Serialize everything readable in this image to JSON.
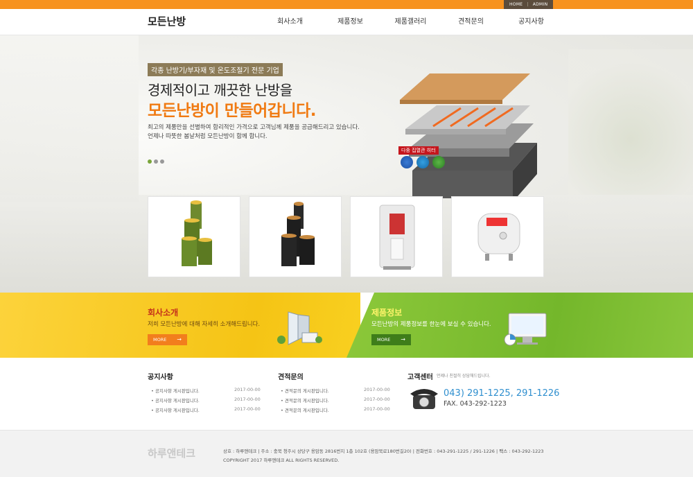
{
  "topbar": {
    "home": "HOME",
    "sep": "|",
    "admin": "ADMIN"
  },
  "header": {
    "logo": "모든난방",
    "nav": [
      "회사소개",
      "제품정보",
      "제품갤러리",
      "견적문의",
      "공지사항"
    ]
  },
  "hero": {
    "tag": "각종 난방기/부자재 및 온도조절기 전문 기업",
    "headline1": "경제적이고 깨끗한 난방을",
    "headline2": "모든난방이 만들어갑니다.",
    "desc1": "최고의 제품만을 선별하여 합리적인 가격으로 고객님께 제품을 공급해드리고 있습니다.",
    "desc2": "언제나 따뜻한 봄날처럼 모든난방이 함께 합니다.",
    "badge": "다중 집열관 히터",
    "slide_active": 1,
    "slide_count": 3
  },
  "products": [
    {
      "icon": "heating-film-roll-green-icon"
    },
    {
      "icon": "heating-film-roll-black-icon"
    },
    {
      "icon": "electric-boiler-icon"
    },
    {
      "icon": "water-heater-icon"
    }
  ],
  "banners": {
    "company": {
      "title": "회사소개",
      "desc": "저희 모든난방에 대해 자세히 소개해드립니다.",
      "more": "MORE"
    },
    "product": {
      "title": "제품정보",
      "desc": "모든난방의 제품정보를 한눈에 보실 수 있습니다.",
      "more": "MORE"
    }
  },
  "notice": {
    "title": "공지사항",
    "items": [
      {
        "text": "공지사항 게시판입니다.",
        "date": "2017-00-00"
      },
      {
        "text": "공지사항 게시판입니다.",
        "date": "2017-00-00"
      },
      {
        "text": "공지사항 게시판입니다.",
        "date": "2017-00-00"
      }
    ]
  },
  "estimate": {
    "title": "견적문의",
    "items": [
      {
        "text": "견적문의 게시판입니다.",
        "date": "2017-00-00"
      },
      {
        "text": "견적문의 게시판입니다.",
        "date": "2017-00-00"
      },
      {
        "text": "견적문의 게시판입니다.",
        "date": "2017-00-00"
      }
    ]
  },
  "cs": {
    "title": "고객센터",
    "sub": "언제나 친절히 상담해드립니다.",
    "tel": "043) 291-1225, 291-1226",
    "fax": "FAX. 043-292-1223"
  },
  "footer": {
    "logo": "하루앤테크",
    "info": "상호 : 하루앤테크  |  주소 : 충북 청주시 상당구 용암동 2816번지 1층 102호 (용암북로180번길20)  |  전화번호 : 043-291-1225 / 291-1226  |  팩스 : 043-292-1223",
    "copyright": "COPYRIGHT 2017 하루앤테크 ALL RIGHTS RESERVED."
  },
  "colors": {
    "accent_orange": "#f7921e",
    "headline_orange": "#f07a12",
    "yellow_banner": "#f5c415",
    "green_banner": "#74b72b",
    "tel_blue": "#2f8fcf"
  }
}
